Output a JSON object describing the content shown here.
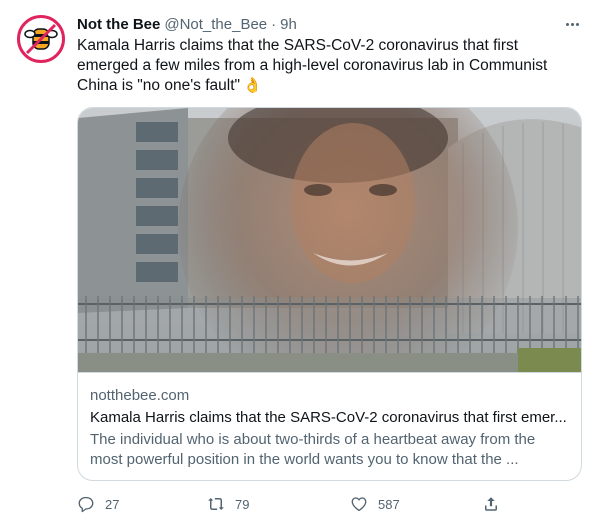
{
  "tweet": {
    "author": {
      "display_name": "Not the Bee",
      "handle": "@Not_the_Bee",
      "separator": "·",
      "time": "9h",
      "avatar_icon": "bee-logo-icon"
    },
    "text": "Kamala Harris claims that the SARS-CoV-2 coronavirus that first emerged a few miles from a high-level coronavirus lab in Communist China is \"no one's fault\"",
    "emoji": "👌",
    "more_icon": "more-dots-icon",
    "card": {
      "domain": "notthebee.com",
      "title": "Kamala Harris claims that the SARS-CoV-2 coronavirus that first emer...",
      "description": "The individual who is about two-thirds of a heartbeat away from the most powerful position in the world wants you to know that the ...",
      "image_icon": "article-thumbnail-image"
    },
    "actions": {
      "reply_count": "27",
      "retweet_count": "79",
      "like_count": "587",
      "reply_icon": "reply-icon",
      "retweet_icon": "retweet-icon",
      "like_icon": "heart-icon",
      "share_icon": "share-icon"
    }
  },
  "colors": {
    "text_primary": "#0f1419",
    "text_secondary": "#536471",
    "border": "#cfd9de",
    "avatar_ring": "#e0245e",
    "avatar_bee": "#f5a623"
  }
}
